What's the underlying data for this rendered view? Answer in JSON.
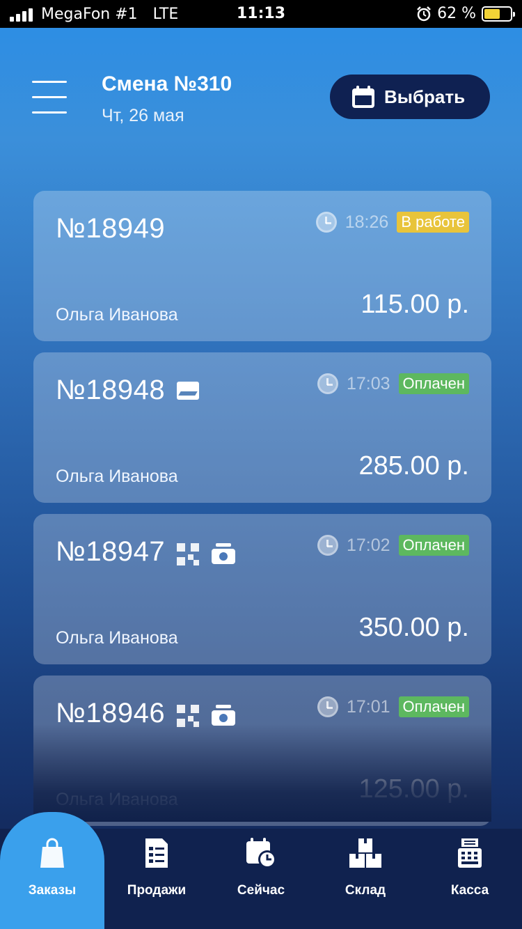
{
  "status_bar": {
    "carrier": "MegaFon #1",
    "network": "LTE",
    "time": "11:13",
    "battery_percent": "62 %",
    "battery_level": 0.62,
    "alarm_icon": "alarm-icon"
  },
  "header": {
    "title": "Смена №310",
    "subtitle": "Чт, 26 мая",
    "select_label": "Выбрать",
    "menu_icon": "hamburger-menu-icon",
    "select_icon": "calendar-icon"
  },
  "orders": [
    {
      "number": "№18949",
      "time": "18:26",
      "status": "В работе",
      "status_type": "work",
      "customer": "Ольга Иванова",
      "amount": "115.00 р.",
      "payment_icons": []
    },
    {
      "number": "№18948",
      "time": "17:03",
      "status": "Оплачен",
      "status_type": "paid",
      "customer": "Ольга Иванова",
      "amount": "285.00 р.",
      "payment_icons": [
        "card-icon"
      ]
    },
    {
      "number": "№18947",
      "time": "17:02",
      "status": "Оплачен",
      "status_type": "paid",
      "customer": "Ольга Иванова",
      "amount": "350.00 р.",
      "payment_icons": [
        "qr-icon",
        "cash-icon"
      ]
    },
    {
      "number": "№18946",
      "time": "17:01",
      "status": "Оплачен",
      "status_type": "paid",
      "customer": "Ольга Иванова",
      "amount": "125.00 р.",
      "payment_icons": [
        "qr-icon",
        "cash-icon"
      ]
    }
  ],
  "tabs": [
    {
      "label": "Заказы",
      "icon": "shopping-bag-icon",
      "active": true
    },
    {
      "label": "Продажи",
      "icon": "receipt-icon",
      "active": false
    },
    {
      "label": "Сейчас",
      "icon": "calendar-clock-icon",
      "active": false
    },
    {
      "label": "Склад",
      "icon": "boxes-icon",
      "active": false
    },
    {
      "label": "Касса",
      "icon": "cash-register-icon",
      "active": false
    }
  ],
  "colors": {
    "badge_work": "#e8c43b",
    "badge_paid": "#5db85f",
    "tab_active": "#3aa0ec",
    "tabbar": "#10224f",
    "select_button": "#0f2152"
  }
}
